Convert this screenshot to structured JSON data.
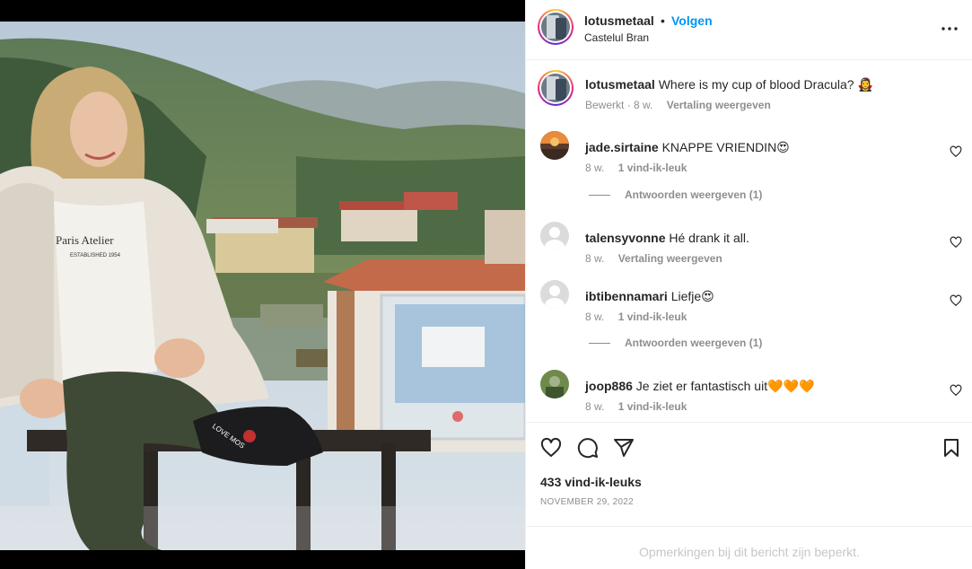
{
  "header": {
    "username": "lotusmetaal",
    "separator": "•",
    "follow_label": "Volgen",
    "location": "Castelul Bran"
  },
  "caption": {
    "username": "lotusmetaal",
    "text": "Where is my cup of blood Dracula? 🧛‍♀️",
    "edited_label": "Bewerkt",
    "time": "· 8 w.",
    "translate_label": "Vertaling weergeven"
  },
  "comments": [
    {
      "username": "jade.sirtaine",
      "text": "KNAPPE VRIENDIN😍",
      "time": "8 w.",
      "action": "1 vind-ik-leuk",
      "replies": "Antwoorden weergeven (1)"
    },
    {
      "username": "talensyvonne",
      "text": "Hé drank it all.",
      "time": "8 w.",
      "action": "Vertaling weergeven"
    },
    {
      "username": "ibtibennamari",
      "text": "Liefje😍",
      "time": "8 w.",
      "action": "1 vind-ik-leuk",
      "replies": "Antwoorden weergeven (1)"
    },
    {
      "username": "joop886",
      "text": "Je ziet er fantastisch uit🧡🧡🧡",
      "time": "8 w.",
      "action": "1 vind-ik-leuk"
    }
  ],
  "actions": {
    "icons": [
      "heart-icon",
      "comment-icon",
      "share-icon",
      "bookmark-icon"
    ],
    "likes": "433 vind-ik-leuks",
    "date": "NOVEMBER 29, 2022"
  },
  "footer": {
    "restricted_text": "Opmerkingen bij dit bericht zijn beperkt."
  },
  "colors": {
    "link_blue": "#0095f6",
    "text": "#262626",
    "muted": "#8e8e8e",
    "border": "#efefef"
  }
}
